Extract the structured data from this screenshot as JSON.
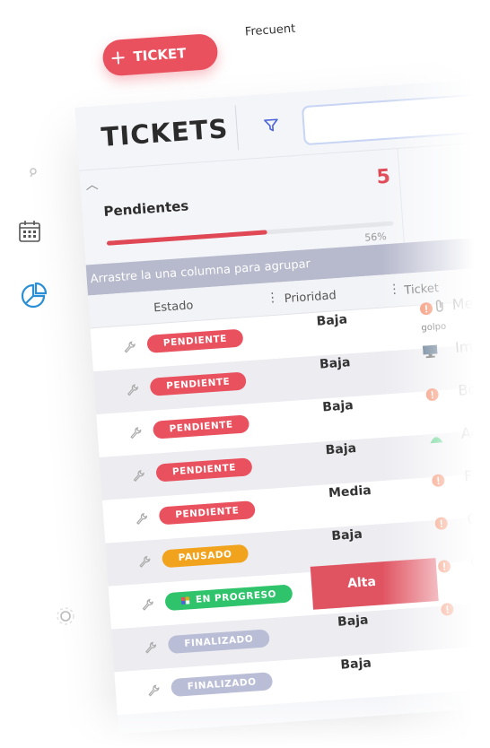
{
  "toolbar": {
    "new_ticket_label": "TICKET",
    "plus_glyph": "+",
    "frequent_label": "Frecuent"
  },
  "header": {
    "title": "TICKETS",
    "search_placeholder": ""
  },
  "summary": {
    "label": "Pendientes",
    "count": "5",
    "percent_text": "56%",
    "progress_fraction": 0.56
  },
  "grid": {
    "group_hint": "Arrastre la una columna para agrupar",
    "columns": {
      "estado": "Estado",
      "prioridad": "Prioridad",
      "ticket": "Ticket"
    },
    "rows": [
      {
        "estado": "PENDIENTE",
        "status_color": "#e9515f",
        "prioridad": "Baja",
        "ticket": "Mesa",
        "ticket_icon": "alert-icon",
        "sub": "golpo"
      },
      {
        "estado": "PENDIENTE",
        "status_color": "#e9515f",
        "prioridad": "Baja",
        "ticket": "Impres",
        "ticket_icon": "monitor-icon",
        "sub": ""
      },
      {
        "estado": "PENDIENTE",
        "status_color": "#e9515f",
        "prioridad": "Baja",
        "ticket": "Bombil",
        "ticket_icon": "alert-icon",
        "sub": ""
      },
      {
        "estado": "PENDIENTE",
        "status_color": "#e9515f",
        "prioridad": "Baja",
        "ticket": "Acond",
        "ticket_icon": "bell-icon",
        "sub": ""
      },
      {
        "estado": "PENDIENTE",
        "status_color": "#e9515f",
        "prioridad": "Media",
        "ticket": "Fuga",
        "ticket_icon": "alert-icon",
        "sub": ""
      },
      {
        "estado": "PAUSADO",
        "status_color": "#f2a31d",
        "prioridad": "Baja",
        "ticket": "Con",
        "ticket_icon": "alert-icon",
        "sub": ""
      },
      {
        "estado": "EN PROGRESO",
        "status_color": "#2fc36b",
        "prioridad": "Alta",
        "ticket": "C",
        "ticket_icon": "alert-icon",
        "sub": ""
      },
      {
        "estado": "FINALIZADO",
        "status_color": "#b9bdd6",
        "prioridad": "Baja",
        "ticket": "",
        "ticket_icon": "alert-icon",
        "sub": ""
      },
      {
        "estado": "FINALIZADO",
        "status_color": "#b9bdd6",
        "prioridad": "Baja",
        "ticket": "",
        "ticket_icon": "",
        "sub": ""
      }
    ]
  },
  "colors": {
    "accent": "#e9515f",
    "filter": "#4a63d8",
    "pie_icon": "#2a8fd6"
  }
}
